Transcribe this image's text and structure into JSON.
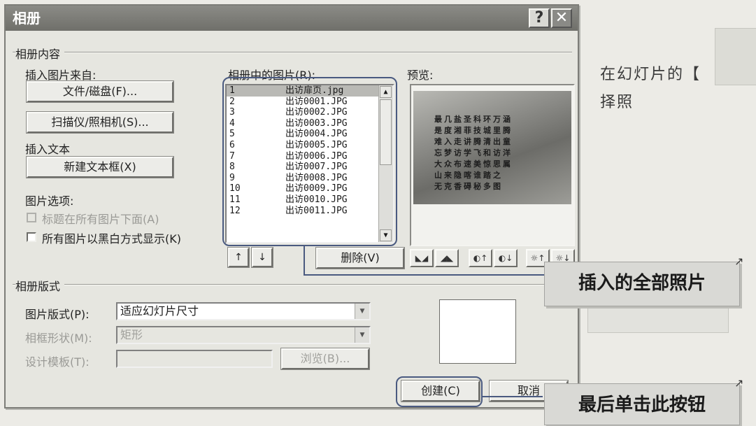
{
  "background": {
    "lines": [
      "在幻灯片的【",
      "择照"
    ],
    "stamp": "单击此按钮"
  },
  "dialog": {
    "title": "相册",
    "help_glyph": "?",
    "close_glyph": "✕",
    "album_content": {
      "group_label": "相册内容",
      "insert_from_label": "插入图片来自:",
      "file_disk_button": "文件/磁盘(F)...",
      "scanner_camera_button": "扫描仪/照相机(S)...",
      "insert_text_label": "插入文本",
      "new_textbox_button": "新建文本框(X)",
      "picture_options_label": "图片选项:",
      "captions_below_label": "标题在所有图片下面(A)",
      "captions_below_checked": false,
      "black_white_label": "所有图片以黑白方式显示(K)",
      "black_white_checked": false
    },
    "pictures_list": {
      "label": "相册中的图片(R):",
      "items": [
        {
          "num": "1",
          "name": "出访扉页.jpg",
          "selected": true
        },
        {
          "num": "2",
          "name": "出访0001.JPG",
          "selected": false
        },
        {
          "num": "3",
          "name": "出访0002.JPG",
          "selected": false
        },
        {
          "num": "4",
          "name": "出访0003.JPG",
          "selected": false
        },
        {
          "num": "5",
          "name": "出访0004.JPG",
          "selected": false
        },
        {
          "num": "6",
          "name": "出访0005.JPG",
          "selected": false
        },
        {
          "num": "7",
          "name": "出访0006.JPG",
          "selected": false
        },
        {
          "num": "8",
          "name": "出访0007.JPG",
          "selected": false
        },
        {
          "num": "9",
          "name": "出访0008.JPG",
          "selected": false
        },
        {
          "num": "10",
          "name": "出访0009.JPG",
          "selected": false
        },
        {
          "num": "11",
          "name": "出访0010.JPG",
          "selected": false
        },
        {
          "num": "12",
          "name": "出访0011.JPG",
          "selected": false
        }
      ],
      "move_up_glyph": "↑",
      "move_down_glyph": "↓",
      "remove_button": "删除(V)"
    },
    "preview": {
      "label": "预览:",
      "image_text_lines": [
        "最几盐圣科环万涵",
        "是度湘菲技城里腾",
        "难入走讲腾清出童",
        "忘梦访学飞和访洋",
        "大众布速美惊思属",
        "山来隐喀谁踏之",
        "无克香碍秘多图"
      ],
      "tool_icons": [
        "rotate-left-icon",
        "rotate-right-icon",
        "contrast-up-icon",
        "contrast-down-icon",
        "brightness-up-icon",
        "brightness-down-icon"
      ],
      "tool_glyphs": [
        "◣◢",
        "◢◣",
        "◐↑",
        "◐↓",
        "☼↑",
        "☼↓"
      ]
    },
    "album_layout": {
      "group_label": "相册版式",
      "picture_layout_label": "图片版式(P):",
      "picture_layout_value": "适应幻灯片尺寸",
      "frame_shape_label": "相框形状(M):",
      "frame_shape_value": "矩形",
      "design_template_label": "设计模板(T):",
      "design_template_value": "",
      "browse_button": "浏览(B)..."
    },
    "create_button": "创建(C)",
    "cancel_button": "取消"
  },
  "callouts": {
    "all_photos": "插入的全部照片",
    "click_button": "最后单击此按钮"
  },
  "colors": {
    "highlight": "#4a5a80",
    "titlebar": "#7c7c77",
    "dialog_bg": "#e6e6e0"
  }
}
